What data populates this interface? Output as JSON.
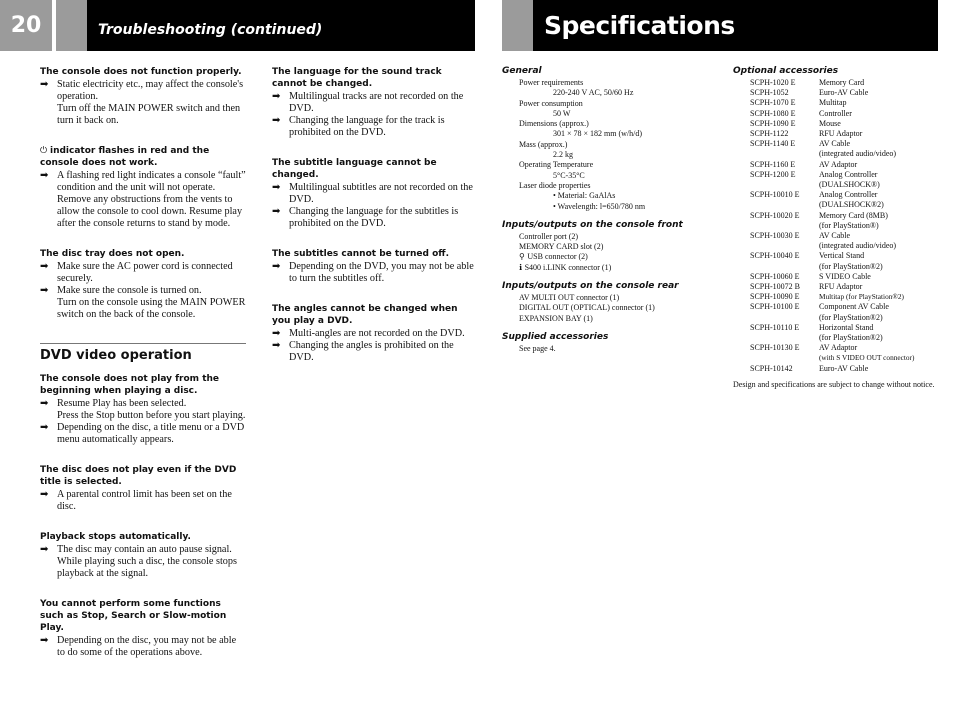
{
  "left_page": {
    "page_number": "20",
    "header_title": "Troubleshooting (continued)",
    "column1": [
      {
        "question": "The console does not function properly.",
        "answers": [
          {
            "text": "Static electricity etc., may affect the console's operation.",
            "extra": [
              "Turn off the MAIN POWER switch and then turn it back on."
            ]
          }
        ]
      },
      {
        "question_icon": "⏻",
        "question": "indicator flashes in red and the console does not work.",
        "answers": [
          {
            "text": "A flashing red light indicates a console “fault” condition and the unit will not operate. Remove any obstructions from the vents to allow the console to cool down. Resume play after the console returns to stand by mode.",
            "extra": []
          }
        ]
      },
      {
        "question": "The disc tray does not open.",
        "answers": [
          {
            "text": "Make sure the AC power cord is connected securely.",
            "extra": []
          },
          {
            "text": "Make sure the console is turned on.",
            "extra": [
              "Turn on the console using the MAIN POWER switch on the back of the console."
            ]
          }
        ]
      }
    ],
    "dvd_section": {
      "title": "DVD video operation",
      "items": [
        {
          "question": "The console does not play from the beginning when playing a disc.",
          "answers": [
            {
              "text": "Resume Play has been selected.",
              "extra": [
                "Press the Stop button before you start playing."
              ]
            },
            {
              "text": "Depending on the disc, a title menu or a DVD menu automatically appears.",
              "extra": []
            }
          ]
        },
        {
          "question": "The disc does not play even if the DVD title is selected.",
          "answers": [
            {
              "text": "A parental control limit has been set on the disc.",
              "extra": []
            }
          ]
        },
        {
          "question": "Playback stops automatically.",
          "answers": [
            {
              "text": "The disc may contain an auto pause signal. While playing such a disc, the console stops playback at the signal.",
              "extra": []
            }
          ]
        },
        {
          "question": "You cannot perform some functions such as Stop, Search or Slow-motion Play.",
          "answers": [
            {
              "text": "Depending on the disc, you may not be able to do some of the operations above.",
              "extra": []
            }
          ]
        }
      ]
    },
    "column2": [
      {
        "question": "The language for the sound track cannot be changed.",
        "answers": [
          {
            "text": "Multilingual tracks are not recorded on the DVD.",
            "extra": []
          },
          {
            "text": "Changing the language for the track is prohibited on the DVD.",
            "extra": []
          }
        ]
      },
      {
        "question": "The subtitle language cannot be changed.",
        "answers": [
          {
            "text": "Multilingual subtitles are not recorded on the DVD.",
            "extra": []
          },
          {
            "text": "Changing the language for the subtitles is prohibited on the DVD.",
            "extra": []
          }
        ]
      },
      {
        "question": "The subtitles cannot be turned off.",
        "answers": [
          {
            "text": "Depending on the DVD, you may not be able to turn the subtitles off.",
            "extra": []
          }
        ]
      },
      {
        "question": "The angles cannot be changed when you play a DVD.",
        "answers": [
          {
            "text": "Multi-angles are not recorded on the DVD.",
            "extra": []
          },
          {
            "text": "Changing the angles is prohibited on the DVD.",
            "extra": []
          }
        ]
      }
    ],
    "arrow_icon": "➡"
  },
  "right_page": {
    "header_title": "Specifications",
    "general": {
      "heading": "General",
      "specs": [
        {
          "label": "Power requirements",
          "values": [
            "220-240 V AC, 50/60 Hz"
          ]
        },
        {
          "label": "Power consumption",
          "values": [
            "50 W"
          ]
        },
        {
          "label": "Dimensions (approx.)",
          "values": [
            "301 × 78 × 182 mm (w/h/d)"
          ]
        },
        {
          "label": "Mass (approx.)",
          "values": [
            "2.2 kg"
          ]
        },
        {
          "label": "Operating Temperature",
          "values": [
            "5°C-35°C"
          ]
        },
        {
          "label": "Laser diode properties",
          "bullets": [
            "Material: GaAlAs",
            "Wavelength: l=650/780 nm"
          ]
        }
      ]
    },
    "front_io": {
      "heading": "Inputs/outputs on the console front",
      "lines": [
        {
          "icon": "",
          "text": "Controller port (2)"
        },
        {
          "icon": "",
          "text": "MEMORY CARD slot (2)"
        },
        {
          "icon": "⚲",
          "text": "USB connector (2)"
        },
        {
          "icon": "ℹ",
          "text": "S400 i.LINK connector (1)"
        }
      ]
    },
    "rear_io": {
      "heading": "Inputs/outputs on the console rear",
      "lines": [
        "AV MULTI OUT connector (1)",
        "DIGITAL OUT (OPTICAL) connector (1)",
        "EXPANSION BAY (1)"
      ]
    },
    "supplied": {
      "heading": "Supplied accessories",
      "lines": [
        "See page 4."
      ]
    },
    "optional": {
      "heading": "Optional accessories",
      "items": [
        {
          "model": "SCPH-1020 E",
          "name": [
            "Memory Card"
          ]
        },
        {
          "model": "SCPH-1052",
          "name": [
            "Euro-AV Cable"
          ]
        },
        {
          "model": "SCPH-1070 E",
          "name": [
            "Multitap"
          ]
        },
        {
          "model": "SCPH-1080 E",
          "name": [
            "Controller"
          ]
        },
        {
          "model": "SCPH-1090 E",
          "name": [
            "Mouse"
          ]
        },
        {
          "model": "SCPH-1122",
          "name": [
            "RFU Adaptor"
          ]
        },
        {
          "model": "SCPH-1140 E",
          "name": [
            "AV Cable",
            "(integrated audio/video)"
          ]
        },
        {
          "model": "SCPH-1160 E",
          "name": [
            "AV Adaptor"
          ]
        },
        {
          "model": "SCPH-1200 E",
          "name": [
            "Analog Controller",
            "(DUALSHOCK®)"
          ]
        },
        {
          "model": "SCPH-10010 E",
          "name": [
            "Analog Controller",
            "(DUALSHOCK®2)"
          ]
        },
        {
          "model": "SCPH-10020 E",
          "name": [
            "Memory Card (8MB)",
            "(for PlayStation®)"
          ]
        },
        {
          "model": "SCPH-10030 E",
          "name": [
            "AV Cable",
            "(integrated audio/video)"
          ]
        },
        {
          "model": "SCPH-10040 E",
          "name": [
            "Vertical Stand",
            "(for PlayStation®2)"
          ]
        },
        {
          "model": "SCPH-10060 E",
          "name": [
            "S VIDEO Cable"
          ]
        },
        {
          "model": "SCPH-10072 B",
          "name": [
            "RFU Adaptor"
          ]
        },
        {
          "model": "SCPH-10090 E",
          "name": [
            "Multitap (for PlayStation®2)"
          ]
        },
        {
          "model": "SCPH-10100 E",
          "name": [
            "Component AV Cable",
            "(for PlayStation®2)"
          ]
        },
        {
          "model": "SCPH-10110 E",
          "name": [
            "Horizontal Stand",
            "(for PlayStation®2)"
          ]
        },
        {
          "model": "SCPH-10130 E",
          "name": [
            "AV Adaptor",
            "(with S VIDEO OUT connector)"
          ]
        },
        {
          "model": "SCPH-10142",
          "name": [
            "Euro-AV Cable"
          ]
        }
      ]
    },
    "note": "Design and specifications are subject to change without notice."
  }
}
